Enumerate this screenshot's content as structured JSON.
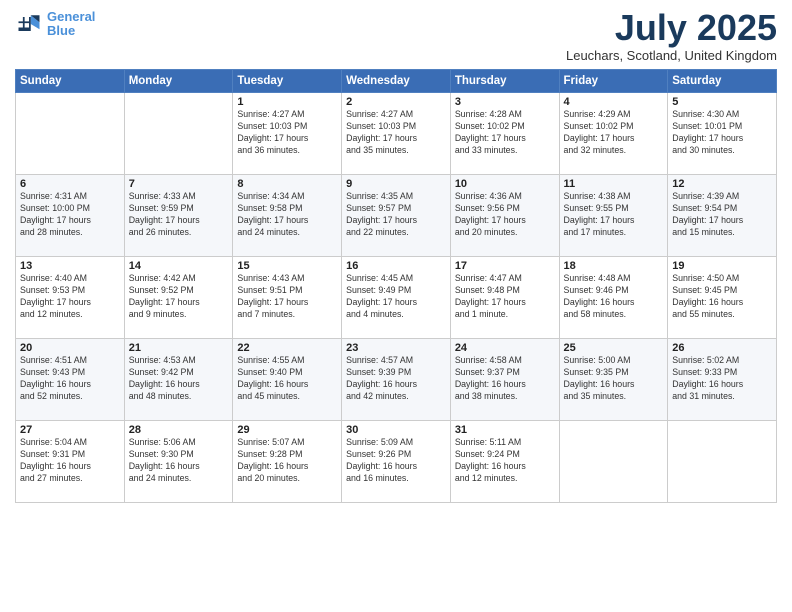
{
  "header": {
    "logo_line1": "General",
    "logo_line2": "Blue",
    "month": "July 2025",
    "location": "Leuchars, Scotland, United Kingdom"
  },
  "weekdays": [
    "Sunday",
    "Monday",
    "Tuesday",
    "Wednesday",
    "Thursday",
    "Friday",
    "Saturday"
  ],
  "weeks": [
    [
      {
        "day": "",
        "detail": ""
      },
      {
        "day": "",
        "detail": ""
      },
      {
        "day": "1",
        "detail": "Sunrise: 4:27 AM\nSunset: 10:03 PM\nDaylight: 17 hours\nand 36 minutes."
      },
      {
        "day": "2",
        "detail": "Sunrise: 4:27 AM\nSunset: 10:03 PM\nDaylight: 17 hours\nand 35 minutes."
      },
      {
        "day": "3",
        "detail": "Sunrise: 4:28 AM\nSunset: 10:02 PM\nDaylight: 17 hours\nand 33 minutes."
      },
      {
        "day": "4",
        "detail": "Sunrise: 4:29 AM\nSunset: 10:02 PM\nDaylight: 17 hours\nand 32 minutes."
      },
      {
        "day": "5",
        "detail": "Sunrise: 4:30 AM\nSunset: 10:01 PM\nDaylight: 17 hours\nand 30 minutes."
      }
    ],
    [
      {
        "day": "6",
        "detail": "Sunrise: 4:31 AM\nSunset: 10:00 PM\nDaylight: 17 hours\nand 28 minutes."
      },
      {
        "day": "7",
        "detail": "Sunrise: 4:33 AM\nSunset: 9:59 PM\nDaylight: 17 hours\nand 26 minutes."
      },
      {
        "day": "8",
        "detail": "Sunrise: 4:34 AM\nSunset: 9:58 PM\nDaylight: 17 hours\nand 24 minutes."
      },
      {
        "day": "9",
        "detail": "Sunrise: 4:35 AM\nSunset: 9:57 PM\nDaylight: 17 hours\nand 22 minutes."
      },
      {
        "day": "10",
        "detail": "Sunrise: 4:36 AM\nSunset: 9:56 PM\nDaylight: 17 hours\nand 20 minutes."
      },
      {
        "day": "11",
        "detail": "Sunrise: 4:38 AM\nSunset: 9:55 PM\nDaylight: 17 hours\nand 17 minutes."
      },
      {
        "day": "12",
        "detail": "Sunrise: 4:39 AM\nSunset: 9:54 PM\nDaylight: 17 hours\nand 15 minutes."
      }
    ],
    [
      {
        "day": "13",
        "detail": "Sunrise: 4:40 AM\nSunset: 9:53 PM\nDaylight: 17 hours\nand 12 minutes."
      },
      {
        "day": "14",
        "detail": "Sunrise: 4:42 AM\nSunset: 9:52 PM\nDaylight: 17 hours\nand 9 minutes."
      },
      {
        "day": "15",
        "detail": "Sunrise: 4:43 AM\nSunset: 9:51 PM\nDaylight: 17 hours\nand 7 minutes."
      },
      {
        "day": "16",
        "detail": "Sunrise: 4:45 AM\nSunset: 9:49 PM\nDaylight: 17 hours\nand 4 minutes."
      },
      {
        "day": "17",
        "detail": "Sunrise: 4:47 AM\nSunset: 9:48 PM\nDaylight: 17 hours\nand 1 minute."
      },
      {
        "day": "18",
        "detail": "Sunrise: 4:48 AM\nSunset: 9:46 PM\nDaylight: 16 hours\nand 58 minutes."
      },
      {
        "day": "19",
        "detail": "Sunrise: 4:50 AM\nSunset: 9:45 PM\nDaylight: 16 hours\nand 55 minutes."
      }
    ],
    [
      {
        "day": "20",
        "detail": "Sunrise: 4:51 AM\nSunset: 9:43 PM\nDaylight: 16 hours\nand 52 minutes."
      },
      {
        "day": "21",
        "detail": "Sunrise: 4:53 AM\nSunset: 9:42 PM\nDaylight: 16 hours\nand 48 minutes."
      },
      {
        "day": "22",
        "detail": "Sunrise: 4:55 AM\nSunset: 9:40 PM\nDaylight: 16 hours\nand 45 minutes."
      },
      {
        "day": "23",
        "detail": "Sunrise: 4:57 AM\nSunset: 9:39 PM\nDaylight: 16 hours\nand 42 minutes."
      },
      {
        "day": "24",
        "detail": "Sunrise: 4:58 AM\nSunset: 9:37 PM\nDaylight: 16 hours\nand 38 minutes."
      },
      {
        "day": "25",
        "detail": "Sunrise: 5:00 AM\nSunset: 9:35 PM\nDaylight: 16 hours\nand 35 minutes."
      },
      {
        "day": "26",
        "detail": "Sunrise: 5:02 AM\nSunset: 9:33 PM\nDaylight: 16 hours\nand 31 minutes."
      }
    ],
    [
      {
        "day": "27",
        "detail": "Sunrise: 5:04 AM\nSunset: 9:31 PM\nDaylight: 16 hours\nand 27 minutes."
      },
      {
        "day": "28",
        "detail": "Sunrise: 5:06 AM\nSunset: 9:30 PM\nDaylight: 16 hours\nand 24 minutes."
      },
      {
        "day": "29",
        "detail": "Sunrise: 5:07 AM\nSunset: 9:28 PM\nDaylight: 16 hours\nand 20 minutes."
      },
      {
        "day": "30",
        "detail": "Sunrise: 5:09 AM\nSunset: 9:26 PM\nDaylight: 16 hours\nand 16 minutes."
      },
      {
        "day": "31",
        "detail": "Sunrise: 5:11 AM\nSunset: 9:24 PM\nDaylight: 16 hours\nand 12 minutes."
      },
      {
        "day": "",
        "detail": ""
      },
      {
        "day": "",
        "detail": ""
      }
    ]
  ]
}
